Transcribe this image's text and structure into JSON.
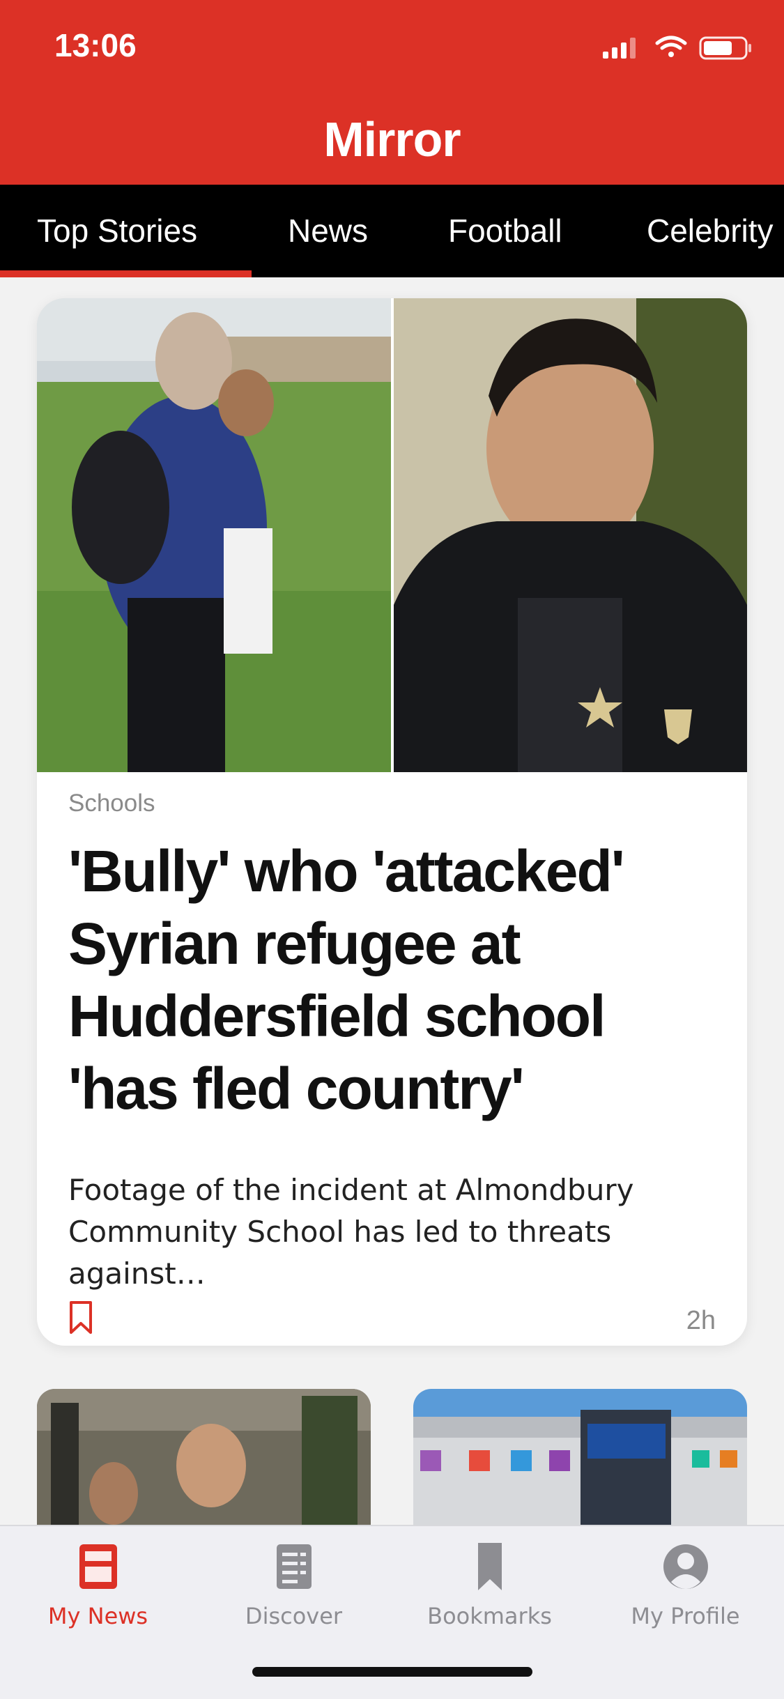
{
  "status_bar": {
    "time": "13:06"
  },
  "header": {
    "logo": "Mirror"
  },
  "tabs": [
    {
      "label": "Top Stories",
      "active": true
    },
    {
      "label": "News",
      "active": false
    },
    {
      "label": "Football",
      "active": false
    },
    {
      "label": "Celebrity",
      "active": false
    }
  ],
  "main_story": {
    "category": "Schools",
    "headline": "'Bully' who 'attacked' Syrian refugee at Huddersfield school 'has fled country'",
    "summary": "Footage of the incident at Almondbury Community School has led to threats against…",
    "age": "2h"
  },
  "bottom_nav": {
    "items": [
      {
        "label": "My News",
        "icon": "my-news-icon",
        "active": true
      },
      {
        "label": "Discover",
        "icon": "discover-icon",
        "active": false
      },
      {
        "label": "Bookmarks",
        "icon": "bookmarks-icon",
        "active": false
      },
      {
        "label": "My Profile",
        "icon": "profile-icon",
        "active": false
      }
    ]
  },
  "colors": {
    "brand_red": "#dc3126",
    "tab_bar_black": "#000000",
    "inactive_grey": "#8d8d92"
  }
}
